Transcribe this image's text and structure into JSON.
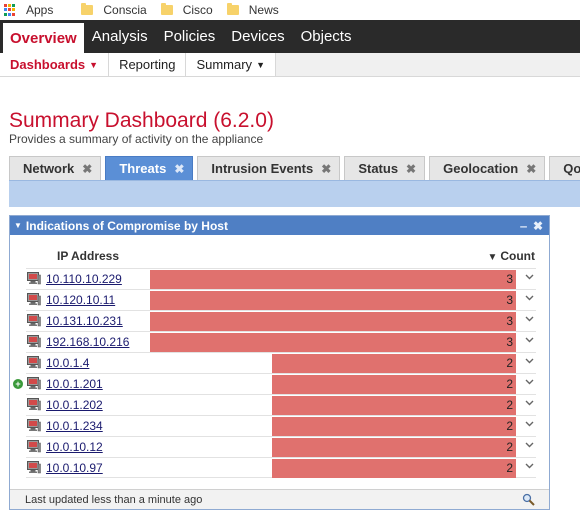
{
  "bookmarks": [
    {
      "label": "Apps",
      "icon": "apps-grid-icon"
    },
    {
      "label": "Conscia",
      "icon": "folder-icon"
    },
    {
      "label": "Cisco",
      "icon": "folder-icon"
    },
    {
      "label": "News",
      "icon": "folder-icon"
    }
  ],
  "main_nav": {
    "items": [
      "Overview",
      "Analysis",
      "Policies",
      "Devices",
      "Objects"
    ],
    "active": "Overview"
  },
  "sub_nav": {
    "items": [
      "Dashboards",
      "Reporting",
      "Summary"
    ],
    "active": "Dashboards"
  },
  "page": {
    "title": "Summary Dashboard (6.2.0)",
    "subtitle": "Provides a summary of activity on the appliance"
  },
  "tabs": {
    "items": [
      "Network",
      "Threats",
      "Intrusion Events",
      "Status",
      "Geolocation",
      "Qo"
    ],
    "active": "Threats",
    "close_glyph": "✖"
  },
  "widget": {
    "title": "Indications of Compromise by Host",
    "minimize_glyph": "‒",
    "close_glyph": "✖",
    "col_ip": "IP Address",
    "col_count": "Count",
    "max_count": 3,
    "rows": [
      {
        "ip": "10.110.10.229",
        "count": "3",
        "new": false
      },
      {
        "ip": "10.120.10.11",
        "count": "3",
        "new": false
      },
      {
        "ip": "10.131.10.231",
        "count": "3",
        "new": false
      },
      {
        "ip": "192.168.10.216",
        "count": "3",
        "new": false
      },
      {
        "ip": "10.0.1.4",
        "count": "2",
        "new": false
      },
      {
        "ip": "10.0.1.201",
        "count": "2",
        "new": true
      },
      {
        "ip": "10.0.1.202",
        "count": "2",
        "new": false
      },
      {
        "ip": "10.0.1.234",
        "count": "2",
        "new": false
      },
      {
        "ip": "10.0.10.12",
        "count": "2",
        "new": false
      },
      {
        "ip": "10.0.10.97",
        "count": "2",
        "new": false
      }
    ],
    "footer": "Last updated less than a minute ago"
  },
  "colors": {
    "brand_red": "#c8102e",
    "nav_dark": "#2a2a2a",
    "tab_active": "#5b8fd6",
    "widget_header": "#4f7fc4",
    "bar": "#e0716e"
  }
}
